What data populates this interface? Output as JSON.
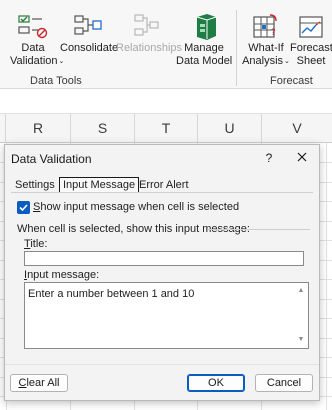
{
  "ribbon": {
    "buttons": [
      {
        "label_line1": "Data",
        "label_line2": "Validation",
        "has_dropdown": true,
        "icon": "data-validation-icon",
        "disabled": false
      },
      {
        "label_line1": "Consolidate",
        "label_line2": "",
        "has_dropdown": false,
        "icon": "consolidate-icon",
        "disabled": false
      },
      {
        "label_line1": "Relationships",
        "label_line2": "",
        "has_dropdown": false,
        "icon": "relationships-icon",
        "disabled": true
      },
      {
        "label_line1": "Manage",
        "label_line2": "Data Model",
        "has_dropdown": false,
        "icon": "data-model-icon",
        "disabled": false
      },
      {
        "label_line1": "What-If",
        "label_line2": "Analysis",
        "has_dropdown": true,
        "icon": "what-if-icon",
        "disabled": false
      },
      {
        "label_line1": "Forecast",
        "label_line2": "Sheet",
        "has_dropdown": false,
        "icon": "forecast-sheet-icon",
        "disabled": false
      }
    ],
    "groups": [
      "Data Tools",
      "Forecast"
    ],
    "dropdown_glyph": "⌄"
  },
  "grid": {
    "columns": [
      "R",
      "S",
      "T",
      "U",
      "V"
    ]
  },
  "dialog": {
    "title": "Data Validation",
    "help": "?",
    "tabs": [
      "Settings",
      "Input Message",
      "Error Alert"
    ],
    "active_tab": "Input Message",
    "checkbox": {
      "label_underlined": "S",
      "label_rest": "how input message when cell is selected",
      "checked": true
    },
    "section_heading": "When cell is selected, show this input message:",
    "title_label_underlined": "T",
    "title_label_rest": "itle:",
    "title_value": "",
    "message_label_underlined": "I",
    "message_label_rest": "nput message:",
    "message_value": "Enter a number between 1 and 10",
    "buttons": {
      "clear_underlined": "C",
      "clear_rest": "lear All",
      "ok": "OK",
      "cancel": "Cancel"
    }
  },
  "colors": {
    "accent": "#0a5cc0",
    "dialog_bg": "#f3f3f3",
    "ribbon_bg": "#f7f7f7"
  }
}
